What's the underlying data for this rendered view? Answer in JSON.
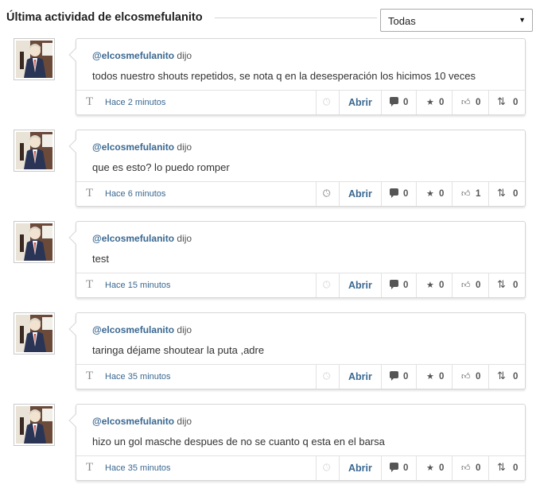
{
  "header": {
    "title": "Última actividad de elcosmefulanito",
    "filter": {
      "selected": "Todas",
      "arrow_icon": "caret-down-icon"
    }
  },
  "common": {
    "said": "dijo",
    "open_label": "Abrir",
    "type_icon_glyph": "T"
  },
  "items": [
    {
      "author": "@elcosmefulanito",
      "message": "todos nuestro shouts repetidos, se nota q en la desesperación los hicimos 10 veces",
      "time": "Hace 2 minutos",
      "clock_active": false,
      "comments": "0",
      "favorites": "0",
      "likes": "0",
      "reshares": "0"
    },
    {
      "author": "@elcosmefulanito",
      "message": "que es esto? lo puedo romper",
      "time": "Hace 6 minutos",
      "clock_active": true,
      "comments": "0",
      "favorites": "0",
      "likes": "1",
      "reshares": "0"
    },
    {
      "author": "@elcosmefulanito",
      "message": "test",
      "time": "Hace 15 minutos",
      "clock_active": false,
      "comments": "0",
      "favorites": "0",
      "likes": "0",
      "reshares": "0"
    },
    {
      "author": "@elcosmefulanito",
      "message": "taringa déjame shoutear la puta ,adre",
      "time": "Hace 35 minutos",
      "clock_active": false,
      "comments": "0",
      "favorites": "0",
      "likes": "0",
      "reshares": "0"
    },
    {
      "author": "@elcosmefulanito",
      "message": "hizo un gol masche despues de no se cuanto q esta en el barsa",
      "time": "Hace 35 minutos",
      "clock_active": false,
      "comments": "0",
      "favorites": "0",
      "likes": "0",
      "reshares": "0"
    }
  ],
  "colors": {
    "link": "#3a6891",
    "text": "#333333",
    "border": "#d6d6d6"
  }
}
